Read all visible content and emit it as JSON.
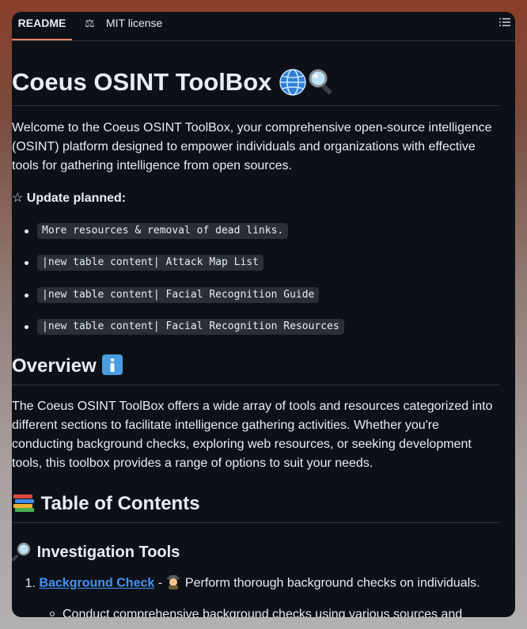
{
  "tabs": {
    "readme": "README",
    "license": "MIT license"
  },
  "doc": {
    "title": "Coeus OSINT ToolBox",
    "intro": "Welcome to the Coeus OSINT ToolBox, your comprehensive open-source intelligence (OSINT) platform designed to empower individuals and organizations with effective tools for gathering intelligence from open sources.",
    "update_star": "☆",
    "update_label": "Update planned:",
    "updates": [
      "More resources & removal of dead links.",
      "|new table content| Attack Map List",
      "|new table content| Facial Recognition Guide",
      "|new table content| Facial Recognition Resources"
    ],
    "overview_heading": "Overview",
    "overview_text": "The Coeus OSINT ToolBox offers a wide array of tools and resources categorized into different sections to facilitate intelligence gathering activities. Whether you're conducting background checks, exploring web resources, or seeking development tools, this toolbox provides a range of options to suit your needs.",
    "toc_heading": "Table of Contents",
    "investigation_heading": "Investigation Tools",
    "ol_items": [
      {
        "num": "1.",
        "link": "Background Check",
        "sep": " - ",
        "desc": " Perform thorough background checks on individuals."
      }
    ],
    "sub_items": [
      "Conduct comprehensive background checks using various sources and"
    ]
  },
  "icons": {
    "license": "scale-icon",
    "outline": "list-outline-icon",
    "globe": "globe-emoji",
    "magnifier": "magnifier-emoji",
    "info": "info-emoji",
    "books": "books-emoji",
    "magnifier_left": "magnifier-left-emoji",
    "detective": "detective-emoji"
  },
  "colors": {
    "background": "#0d1117",
    "text": "#e6edf3",
    "link": "#4493f8",
    "tab_underline": "#f78166",
    "border": "#30363d",
    "code_bg": "#2a2f36"
  }
}
